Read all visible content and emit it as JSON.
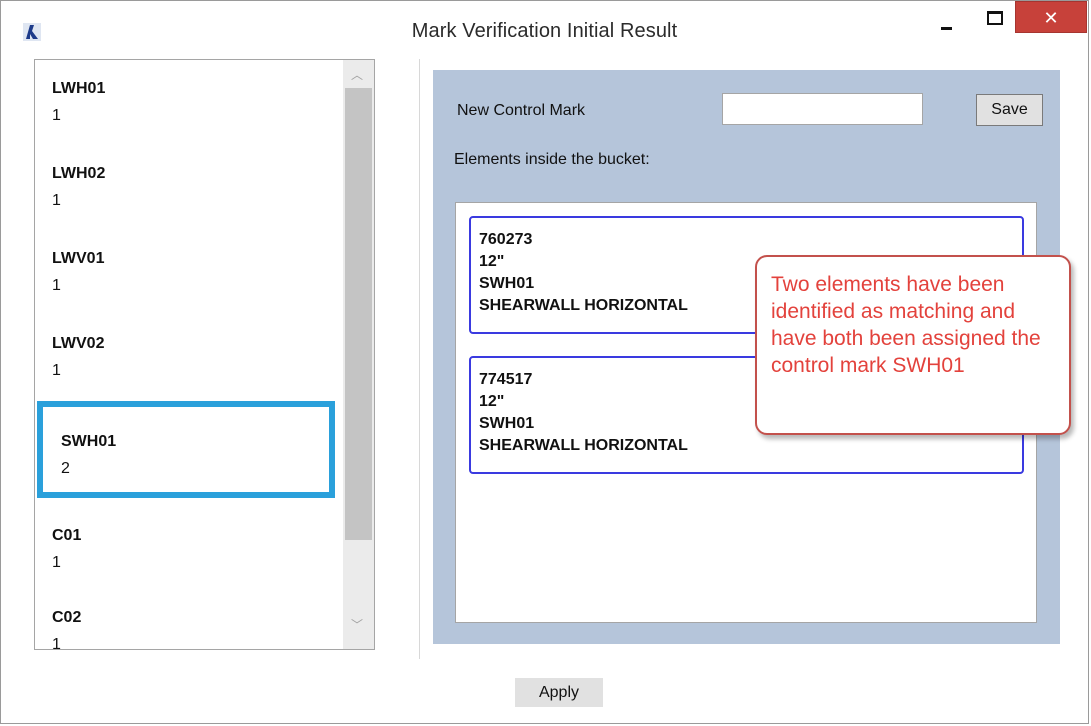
{
  "window": {
    "title": "Mark Verification Initial Result",
    "close_glyph": "✕"
  },
  "marks_list": {
    "items": [
      {
        "name": "LWH01",
        "count": "1"
      },
      {
        "name": "LWH02",
        "count": "1"
      },
      {
        "name": "LWV01",
        "count": "1"
      },
      {
        "name": "LWV02",
        "count": "1"
      },
      {
        "name": "SWH01",
        "count": "2",
        "selected": true
      },
      {
        "name": "C01",
        "count": "1"
      },
      {
        "name": "C02",
        "count": "1"
      }
    ]
  },
  "detail": {
    "new_control_mark_label": "New Control Mark",
    "new_control_mark_value": "",
    "save_label": "Save",
    "elements_label": "Elements inside the bucket:",
    "elements": [
      {
        "id": "760273",
        "size": "12\"",
        "mark": "SWH01",
        "type": "SHEARWALL HORIZONTAL"
      },
      {
        "id": "774517",
        "size": "12\"",
        "mark": "SWH01",
        "type": "SHEARWALL HORIZONTAL"
      }
    ]
  },
  "callout": {
    "text": "Two elements have been identified as matching and have both been assigned the control mark SWH01"
  },
  "footer": {
    "apply_label": "Apply"
  },
  "colors": {
    "panel_bg": "#b5c5da",
    "selection_border": "#2aa0db",
    "card_border": "#3a3ae0",
    "callout_text": "#e3423c",
    "close_button": "#c7413a"
  }
}
